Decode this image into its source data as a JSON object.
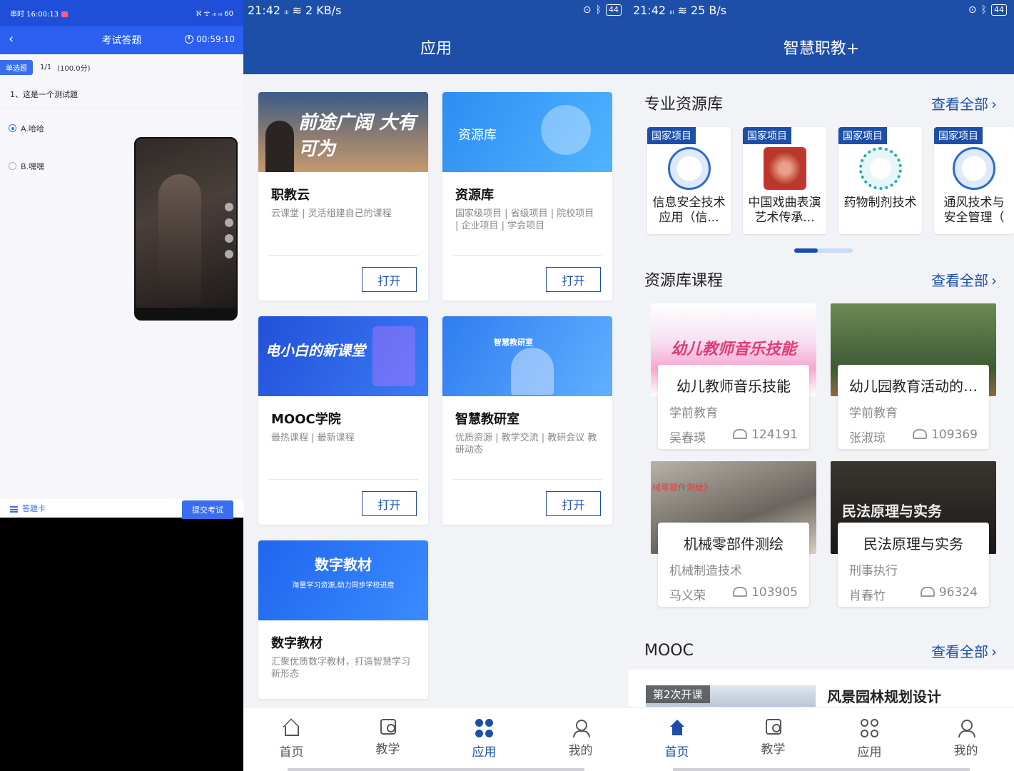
{
  "exam": {
    "status_time": "串时 16:00:13",
    "status_right": "ℵ ᯤ ᵢₗₗ ᵢₗₗ 60",
    "title": "考试答题",
    "timer": "00:59:10",
    "qtype": "单选题",
    "progress": "1/1",
    "score": "(100.0分)",
    "question": "1、这是一个测试题",
    "options": [
      {
        "label": "A.哈哈",
        "selected": true
      },
      {
        "label": "B.嘿嘿",
        "selected": false
      }
    ],
    "answer_card": "答题卡",
    "submit": "提交考试"
  },
  "apps_screen": {
    "status_time": "21:42",
    "status_speed": "2 KB/s",
    "battery": "44",
    "title": "应用",
    "cards": [
      {
        "name": "职教云",
        "desc": "云课堂 | 灵活组建自己的课程",
        "banner_text": "前途广阔 大有可为",
        "open": "打开"
      },
      {
        "name": "资源库",
        "desc": "国家级项目 | 省级项目 | 院校项目 | 企业项目 | 学会项目",
        "banner_text": "资源库",
        "open": "打开"
      },
      {
        "name": "MOOC学院",
        "desc": "最热课程 | 最新课程",
        "banner_text": "电小白的新课堂",
        "open": "打开"
      },
      {
        "name": "智慧教研室",
        "desc": "优质资源 | 教学交流 | 教研会议 教研动态",
        "banner_text": "智慧教研室",
        "open": "打开"
      },
      {
        "name": "数字教材",
        "desc": "汇聚优质数字教材，打造智慧学习新形态",
        "banner_text": "数字教材",
        "banner_sub": "海量学习资源,助力同步学校进度"
      }
    ],
    "nav": [
      "首页",
      "教学",
      "应用",
      "我的"
    ]
  },
  "home_screen": {
    "status_time": "21:42",
    "status_speed": "25 B/s",
    "battery": "44",
    "title": "智慧职教+",
    "see_all": "查看全部",
    "sec_resources": "专业资源库",
    "resources": [
      {
        "badge": "国家项目",
        "name": "信息安全技术应用（信..."
      },
      {
        "badge": "国家项目",
        "name": "中国戏曲表演艺术传承..."
      },
      {
        "badge": "国家项目",
        "name": "药物制剂技术"
      },
      {
        "badge": "国家项目",
        "name": "通风技术与安全管理（"
      }
    ],
    "sec_courses": "资源库课程",
    "courses": [
      {
        "name": "幼儿教师音乐技能",
        "category": "学前教育",
        "teacher": "吴春瑛",
        "count": "124191",
        "img_text": "幼儿教师音乐技能"
      },
      {
        "name": "幼儿园教育活动的设...",
        "category": "学前教育",
        "teacher": "张淑琼",
        "count": "109369"
      },
      {
        "name": "机械零部件测绘",
        "category": "机械制造技术",
        "teacher": "马义荣",
        "count": "103905",
        "img_text": "械零部件测绘》"
      },
      {
        "name": "民法原理与实务",
        "category": "刑事执行",
        "teacher": "肖春竹",
        "count": "96324",
        "img_text": "民法原理与实务"
      }
    ],
    "sec_mooc": "MOOC",
    "mooc_tag": "第2次开课",
    "mooc_name": "风景园林规划设计",
    "nav": [
      "首页",
      "教学",
      "应用",
      "我的"
    ]
  },
  "colors": {
    "primary": "#1d4fa8",
    "exam_blue": "#2a5ff0"
  }
}
